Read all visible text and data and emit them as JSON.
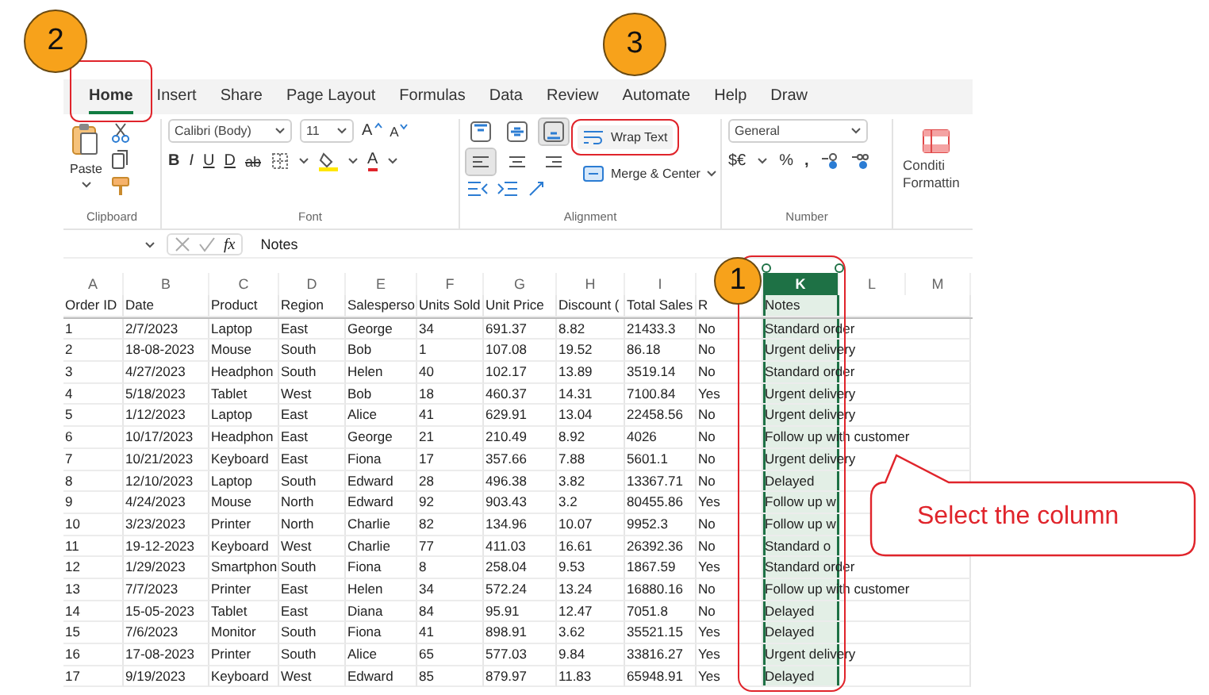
{
  "markers": [
    {
      "label": "2"
    },
    {
      "label": "3"
    },
    {
      "label": "1"
    }
  ],
  "tabs": [
    {
      "label": "Home",
      "selected": true,
      "highlighted": true
    },
    {
      "label": "Insert",
      "selected": false,
      "highlighted": false
    },
    {
      "label": "Share",
      "selected": false,
      "highlighted": false
    },
    {
      "label": "Page Layout",
      "selected": false,
      "highlighted": false
    },
    {
      "label": "Formulas",
      "selected": false,
      "highlighted": false
    },
    {
      "label": "Data",
      "selected": false,
      "highlighted": false
    },
    {
      "label": "Review",
      "selected": false,
      "highlighted": false
    },
    {
      "label": "Automate",
      "selected": false,
      "highlighted": false
    },
    {
      "label": "Help",
      "selected": false,
      "highlighted": false
    },
    {
      "label": "Draw",
      "selected": false,
      "highlighted": false
    }
  ],
  "ribbon": {
    "clipboard": {
      "paste": "Paste",
      "label": "Clipboard"
    },
    "font": {
      "family": "Calibri (Body)",
      "size": "11",
      "grow": "A",
      "shrink": "A",
      "styles": [
        "B",
        "I",
        "U",
        "D",
        "ab"
      ],
      "color_letter": "A",
      "label": "Font"
    },
    "alignment": {
      "vertical": [
        {
          "kind": "top",
          "selected": false
        },
        {
          "kind": "middle",
          "selected": false
        },
        {
          "kind": "bottom",
          "selected": true
        }
      ],
      "horizontal": [
        {
          "kind": "left",
          "selected": true
        },
        {
          "kind": "center",
          "selected": false
        },
        {
          "kind": "right",
          "selected": false
        }
      ],
      "wrap_text": {
        "label": "Wrap Text",
        "highlighted": true
      },
      "merge": "Merge & Center",
      "label": "Alignment"
    },
    "number": {
      "format": "General",
      "currency": "$€",
      "percent": "%",
      "comma": ",",
      "label": "Number"
    },
    "conditional": [
      "Conditi",
      "Formattin"
    ]
  },
  "formula_bar": {
    "fx": "fx",
    "value": "Notes"
  },
  "callout": {
    "text": "Select the column"
  },
  "columns": [
    {
      "letter": "A",
      "selected": false
    },
    {
      "letter": "B",
      "selected": false
    },
    {
      "letter": "C",
      "selected": false
    },
    {
      "letter": "D",
      "selected": false
    },
    {
      "letter": "E",
      "selected": false
    },
    {
      "letter": "F",
      "selected": false
    },
    {
      "letter": "G",
      "selected": false
    },
    {
      "letter": "H",
      "selected": false
    },
    {
      "letter": "I",
      "selected": false
    },
    {
      "selected": false
    },
    {
      "letter": "K",
      "selected": true
    },
    {
      "letter": "L",
      "selected": false
    },
    {
      "letter": "M",
      "selected": false
    }
  ],
  "header": [
    "Order ID",
    "Date",
    "Product",
    "Region",
    "Salesperso",
    "Units Sold",
    "Unit Price",
    "Discount (",
    "Total Sales",
    "R",
    "Notes"
  ],
  "rows": [
    [
      "1",
      "2/7/2023",
      "Laptop",
      "East",
      "George",
      "34",
      "691.37",
      "8.82",
      "21433.3",
      "No",
      "Standard order"
    ],
    [
      "2",
      "18-08-2023",
      "Mouse",
      "South",
      "Bob",
      "1",
      "107.08",
      "19.52",
      "86.18",
      "No",
      "Urgent delivery"
    ],
    [
      "3",
      "4/27/2023",
      "Headphon",
      "South",
      "Helen",
      "40",
      "102.17",
      "13.89",
      "3519.14",
      "No",
      "Standard order"
    ],
    [
      "4",
      "5/18/2023",
      "Tablet",
      "West",
      "Bob",
      "18",
      "460.37",
      "14.31",
      "7100.84",
      "Yes",
      "Urgent delivery"
    ],
    [
      "5",
      "1/12/2023",
      "Laptop",
      "East",
      "Alice",
      "41",
      "629.91",
      "13.04",
      "22458.56",
      "No",
      "Urgent delivery"
    ],
    [
      "6",
      "10/17/2023",
      "Headphon",
      "East",
      "George",
      "21",
      "210.49",
      "8.92",
      "4026",
      "No",
      "Follow up with customer"
    ],
    [
      "7",
      "10/21/2023",
      "Keyboard",
      "East",
      "Fiona",
      "17",
      "357.66",
      "7.88",
      "5601.1",
      "No",
      "Urgent delivery"
    ],
    [
      "8",
      "12/10/2023",
      "Laptop",
      "South",
      "Edward",
      "28",
      "496.38",
      "3.82",
      "13367.71",
      "No",
      "Delayed"
    ],
    [
      "9",
      "4/24/2023",
      "Mouse",
      "North",
      "Edward",
      "92",
      "903.43",
      "3.2",
      "80455.86",
      "Yes",
      "Follow up w"
    ],
    [
      "10",
      "3/23/2023",
      "Printer",
      "North",
      "Charlie",
      "82",
      "134.96",
      "10.07",
      "9952.3",
      "No",
      "Follow up w"
    ],
    [
      "11",
      "19-12-2023",
      "Keyboard",
      "West",
      "Charlie",
      "77",
      "411.03",
      "16.61",
      "26392.36",
      "No",
      "Standard o"
    ],
    [
      "12",
      "1/29/2023",
      "Smartphon",
      "South",
      "Fiona",
      "8",
      "258.04",
      "9.53",
      "1867.59",
      "Yes",
      "Standard order"
    ],
    [
      "13",
      "7/7/2023",
      "Printer",
      "East",
      "Helen",
      "34",
      "572.24",
      "13.24",
      "16880.16",
      "No",
      "Follow up with customer"
    ],
    [
      "14",
      "15-05-2023",
      "Tablet",
      "East",
      "Diana",
      "84",
      "95.91",
      "12.47",
      "7051.8",
      "No",
      "Delayed"
    ],
    [
      "15",
      "7/6/2023",
      "Monitor",
      "South",
      "Fiona",
      "41",
      "898.91",
      "3.62",
      "35521.15",
      "Yes",
      "Delayed"
    ],
    [
      "16",
      "17-08-2023",
      "Printer",
      "South",
      "Alice",
      "65",
      "577.03",
      "9.84",
      "33816.27",
      "Yes",
      "Urgent delivery"
    ],
    [
      "17",
      "9/19/2023",
      "Keyboard",
      "West",
      "Edward",
      "85",
      "879.97",
      "11.83",
      "65948.91",
      "Yes",
      "Delayed"
    ]
  ]
}
